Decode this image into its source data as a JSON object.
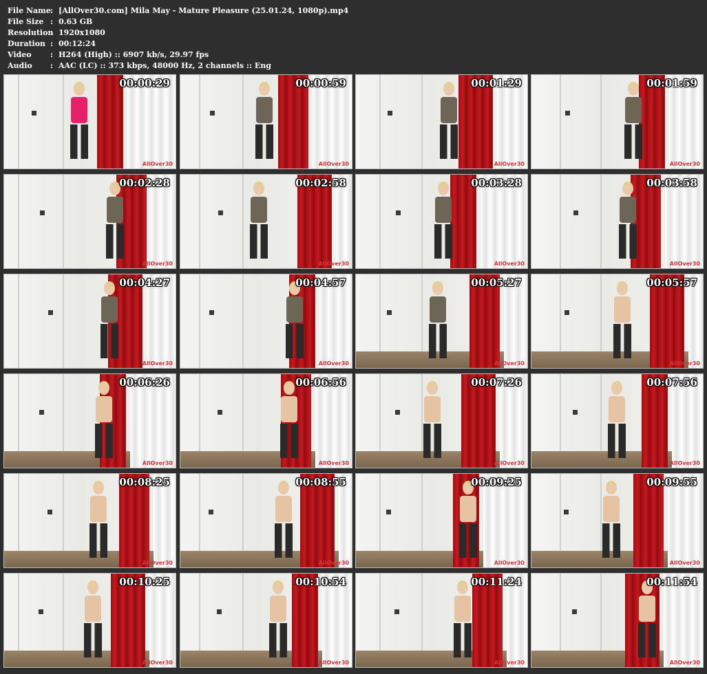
{
  "info": {
    "separator": ":",
    "rows": [
      {
        "label": "File Name",
        "value": "[AllOver30.com] Mila May - Mature Pleasure (25.01.24, 1080p).mp4"
      },
      {
        "label": "File Size",
        "value": "0.63 GB"
      },
      {
        "label": "Resolution",
        "value": "1920x1080"
      },
      {
        "label": "Duration",
        "value": "00:12:24"
      },
      {
        "label": "Video",
        "value": "H264 (High) :: 6907 kb/s, 29.97 fps"
      },
      {
        "label": "Audio",
        "value": "AAC (LC) :: 373 kbps, 48000 Hz, 2 channels :: Eng"
      }
    ]
  },
  "watermark": "AllOver30",
  "colors": {
    "background": "#2e2e2e",
    "curtain": "#b3151a",
    "accent_pink": "#e8206a"
  },
  "thumbnails": [
    {
      "timestamp": "00:00:29"
    },
    {
      "timestamp": "00:00:59"
    },
    {
      "timestamp": "00:01:29"
    },
    {
      "timestamp": "00:01:59"
    },
    {
      "timestamp": "00:02:28"
    },
    {
      "timestamp": "00:02:58"
    },
    {
      "timestamp": "00:03:28"
    },
    {
      "timestamp": "00:03:58"
    },
    {
      "timestamp": "00:04:27"
    },
    {
      "timestamp": "00:04:57"
    },
    {
      "timestamp": "00:05:27"
    },
    {
      "timestamp": "00:05:57"
    },
    {
      "timestamp": "00:06:26"
    },
    {
      "timestamp": "00:06:56"
    },
    {
      "timestamp": "00:07:26"
    },
    {
      "timestamp": "00:07:56"
    },
    {
      "timestamp": "00:08:25"
    },
    {
      "timestamp": "00:08:55"
    },
    {
      "timestamp": "00:09:25"
    },
    {
      "timestamp": "00:09:55"
    },
    {
      "timestamp": "00:10:25"
    },
    {
      "timestamp": "00:10:54"
    },
    {
      "timestamp": "00:11:24"
    },
    {
      "timestamp": "00:11:54"
    }
  ]
}
